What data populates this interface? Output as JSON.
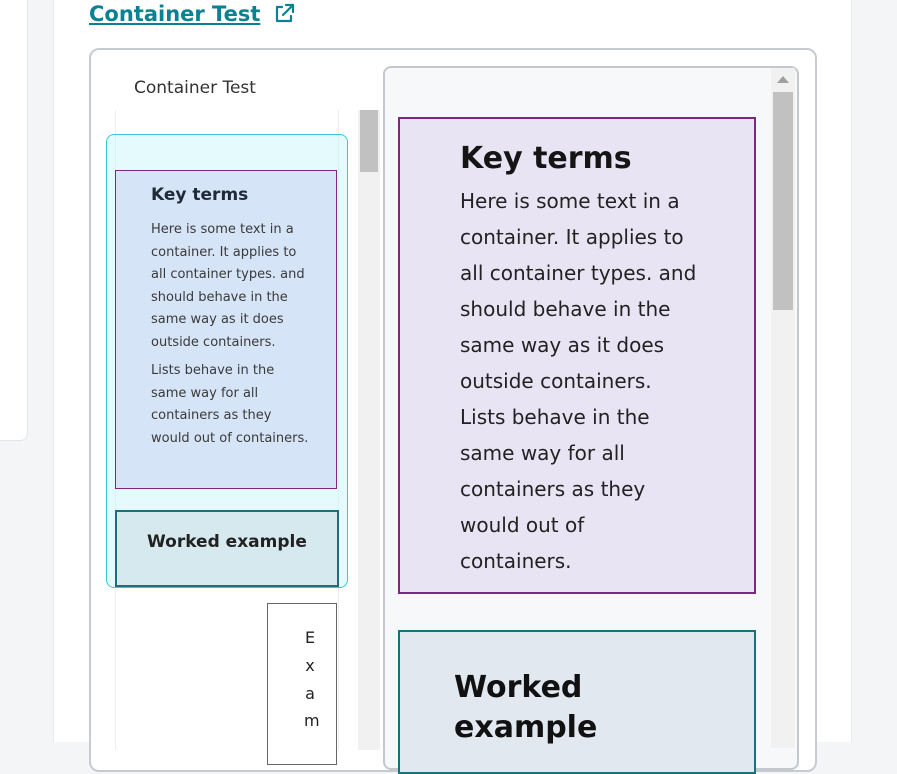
{
  "title_link": {
    "label": "Container Test"
  },
  "preview": {
    "label": "Container Test",
    "key_terms": {
      "heading": "Key terms",
      "paragraph1": "Here is some text in a container. It applies to all container types. and should behave in the same way as it does outside containers.",
      "paragraph2": "Lists behave in the same way for all containers as they would out of containers."
    },
    "worked_example": {
      "heading": "Worked example"
    },
    "example_letters": [
      "E",
      "x",
      "a",
      "m"
    ]
  },
  "detail": {
    "key_terms": {
      "heading": "Key terms",
      "lines": [
        "Here is some text in a",
        "container. It applies to",
        "all container types. and",
        "should behave in the",
        "same way as it does",
        "outside containers.",
        "Lists behave in the",
        "same way for all",
        "containers as they",
        "would out of",
        "containers."
      ]
    },
    "worked_example": {
      "heading": "Worked example"
    }
  },
  "colors": {
    "link": "#0b8193",
    "key_terms_border": "#7a2a7c",
    "worked_example_border": "#1d6f7e",
    "selection": "#3cc7d4"
  },
  "icons": {
    "external_link": "external-link-icon"
  }
}
